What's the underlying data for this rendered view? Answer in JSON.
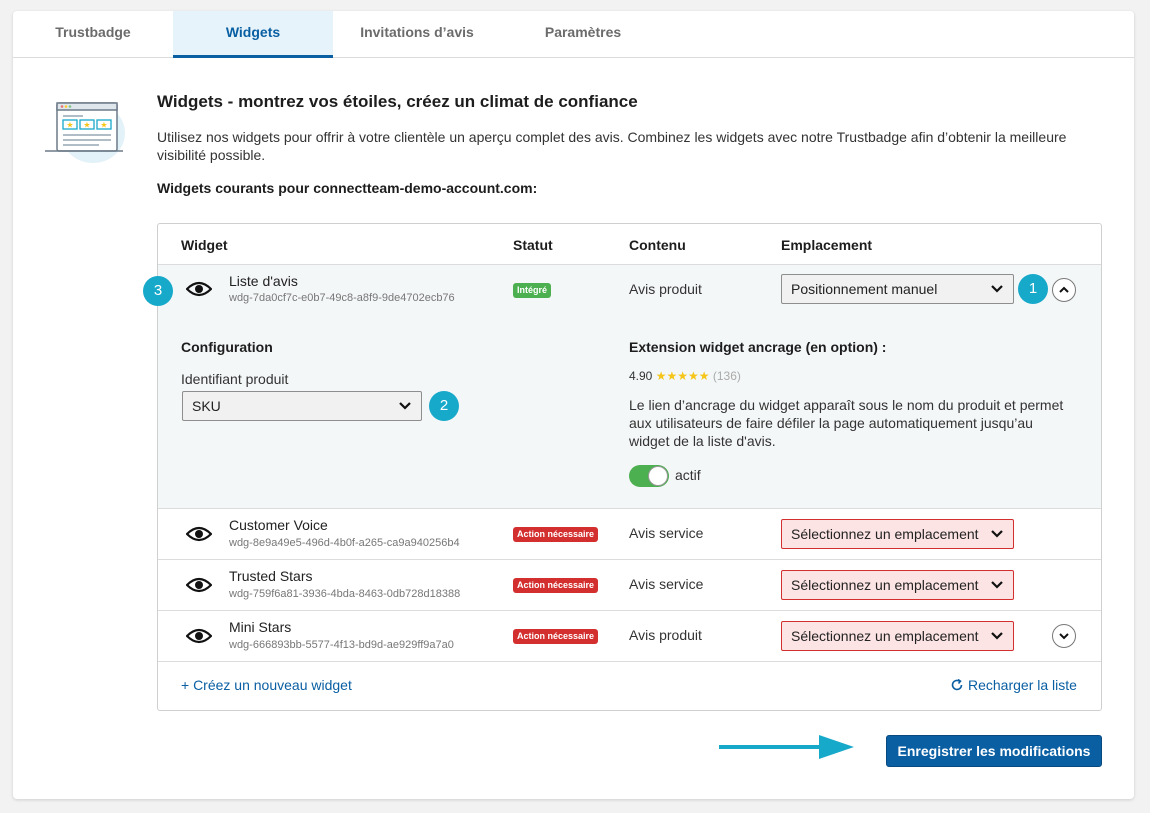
{
  "tabs": [
    {
      "label": "Trustbadge",
      "active": false
    },
    {
      "label": "Widgets",
      "active": true
    },
    {
      "label": "Invitations d’avis",
      "active": false
    },
    {
      "label": "Paramètres",
      "active": false
    }
  ],
  "header": {
    "title": "Widgets - montrez vos étoiles, créez un climat de confiance",
    "description": "Utilisez nos widgets pour offrir à votre clientèle un aperçu complet des avis. Combinez les widgets avec notre Trustbadge afin d’obtenir la meilleure visibilité possible.",
    "current_widgets": "Widgets courants pour connectteam-demo-account.com:"
  },
  "table": {
    "columns": [
      "Widget",
      "Statut",
      "Contenu",
      "Emplacement"
    ],
    "rows": [
      {
        "name": "Liste d'avis",
        "id": "wdg-7da0cf7c-e0b7-49c8-a8f9-9de4702ecb76",
        "status": "Intégré",
        "status_color": "#4caf50",
        "content": "Avis produit",
        "placement": "Positionnement manuel",
        "expanded": true
      },
      {
        "name": "Customer Voice",
        "id": "wdg-8e9a49e5-496d-4b0f-a265-ca9a940256b4",
        "status": "Action nécessaire",
        "status_color": "#d32f2f",
        "content": "Avis service",
        "placement": "Sélectionnez un emplacement"
      },
      {
        "name": "Trusted Stars",
        "id": "wdg-759f6a81-3936-4bda-8463-0db728d18388",
        "status": "Action nécessaire",
        "status_color": "#d32f2f",
        "content": "Avis service",
        "placement": "Sélectionnez un emplacement"
      },
      {
        "name": "Mini Stars",
        "id": "wdg-666893bb-5577-4f13-bd9d-ae929ff9a7a0",
        "status": "Action nécessaire",
        "status_color": "#d32f2f",
        "content": "Avis produit",
        "placement": "Sélectionnez un emplacement"
      }
    ]
  },
  "config": {
    "heading": "Configuration",
    "product_id_label": "Identifiant produit",
    "product_id_value": "SKU",
    "extension_heading": "Extension widget ancrage (en option) :",
    "rating_value": "4.90",
    "rating_stars": "★★★★★",
    "rating_count": "(136)",
    "extension_desc": "Le lien d’ancrage du widget apparaît sous le nom du produit et permet aux utilisateurs de faire défiler la page automatiquement jusqu’au widget de la liste d'avis.",
    "toggle_label": "actif",
    "toggle_on": true
  },
  "markers": [
    "1",
    "2",
    "3"
  ],
  "footer": {
    "create_label": "+ Créez un nouveau widget",
    "reload_label": "Recharger la liste",
    "save_label": "Enregistrer les modifications"
  },
  "colors": {
    "accent": "#0a5fa3",
    "marker": "#17a9ca",
    "success": "#4caf50",
    "danger": "#d32f2f"
  },
  "icons": [
    "eye-icon",
    "chevron-down-icon",
    "chevron-up-icon",
    "reload-icon",
    "arrow-right-icon",
    "widgets-illustration"
  ]
}
